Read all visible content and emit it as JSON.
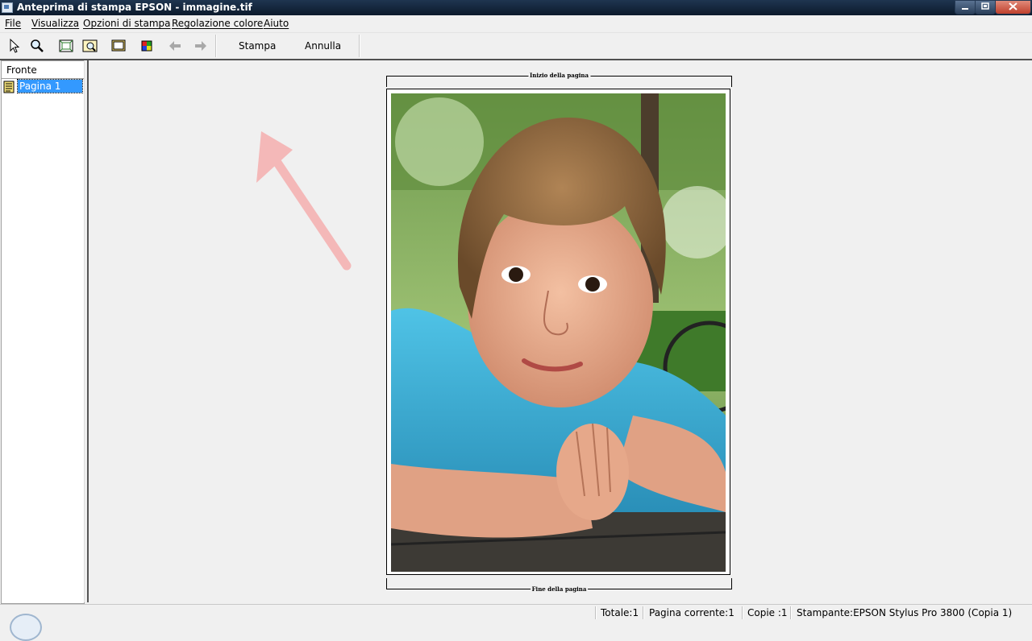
{
  "window": {
    "title": "Anteprima di stampa EPSON - immagine.tif"
  },
  "menu": {
    "items": [
      "File",
      "Visualizza",
      "Opzioni di stampa",
      "Regolazione colore",
      "Aiuto"
    ]
  },
  "toolbar": {
    "icons": [
      "pointer-icon",
      "zoom-icon",
      "fit-page-icon",
      "zoom-page-icon",
      "page-frame-icon",
      "color-icon",
      "back-arrow-icon",
      "forward-arrow-icon"
    ],
    "print_label": "Stampa",
    "cancel_label": "Annulla"
  },
  "tree": {
    "header": "Fronte",
    "selected_item": "Pagina 1"
  },
  "preview": {
    "page_top_label": "Inizio della pagina",
    "page_bottom_label": "Fine della pagina"
  },
  "status": {
    "total": "Totale:1",
    "current_page": "Pagina corrente:1",
    "copies": "Copie :1",
    "printer": "Stampante:EPSON Stylus Pro 3800 (Copia 1)"
  },
  "colors": {
    "titlebar": "#0c1a2c",
    "selection": "#3399ff",
    "annotation_arrow": "#f4b8b8"
  }
}
